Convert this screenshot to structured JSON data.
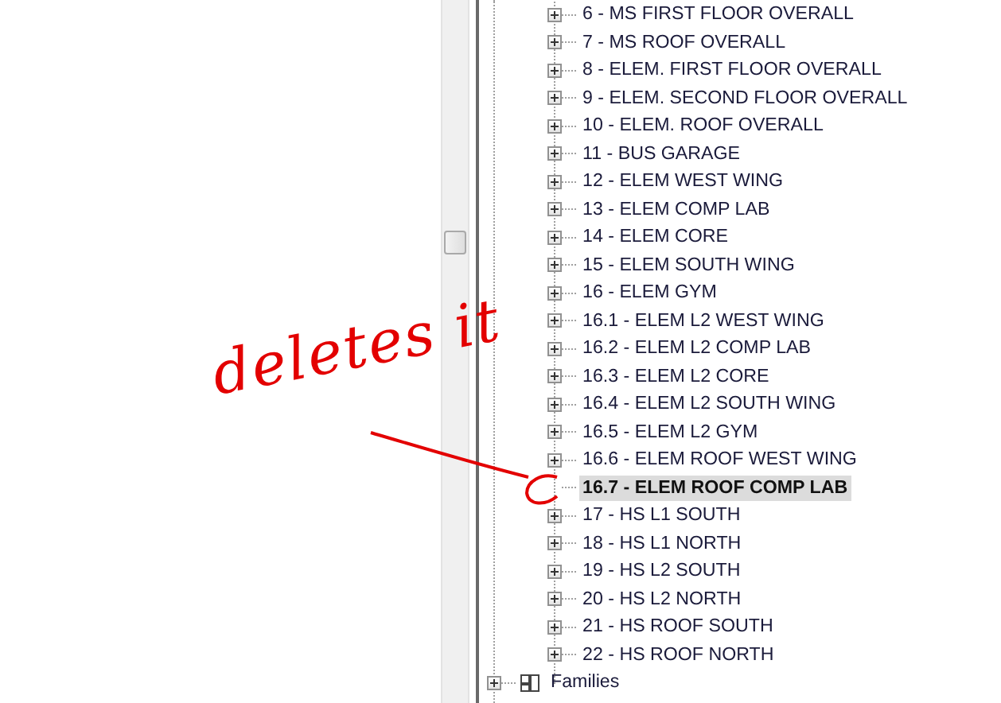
{
  "tree": {
    "items": [
      {
        "label": "6 - MS FIRST FLOOR OVERALL",
        "expandable": true,
        "selected": false
      },
      {
        "label": "7 - MS ROOF OVERALL",
        "expandable": true,
        "selected": false
      },
      {
        "label": "8 - ELEM. FIRST FLOOR OVERALL",
        "expandable": true,
        "selected": false
      },
      {
        "label": "9 - ELEM. SECOND FLOOR OVERALL",
        "expandable": true,
        "selected": false
      },
      {
        "label": "10 - ELEM. ROOF OVERALL",
        "expandable": true,
        "selected": false
      },
      {
        "label": "11 - BUS GARAGE",
        "expandable": true,
        "selected": false
      },
      {
        "label": "12 - ELEM WEST WING",
        "expandable": true,
        "selected": false
      },
      {
        "label": "13 - ELEM COMP LAB",
        "expandable": true,
        "selected": false
      },
      {
        "label": "14 - ELEM CORE",
        "expandable": true,
        "selected": false
      },
      {
        "label": "15 - ELEM SOUTH WING",
        "expandable": true,
        "selected": false
      },
      {
        "label": "16 - ELEM GYM",
        "expandable": true,
        "selected": false
      },
      {
        "label": "16.1 - ELEM L2 WEST WING",
        "expandable": true,
        "selected": false
      },
      {
        "label": "16.2 - ELEM L2 COMP LAB",
        "expandable": true,
        "selected": false
      },
      {
        "label": "16.3 - ELEM L2 CORE",
        "expandable": true,
        "selected": false
      },
      {
        "label": "16.4 - ELEM L2 SOUTH WING",
        "expandable": true,
        "selected": false
      },
      {
        "label": "16.5 - ELEM L2 GYM",
        "expandable": true,
        "selected": false
      },
      {
        "label": "16.6 - ELEM ROOF WEST WING",
        "expandable": true,
        "selected": false
      },
      {
        "label": "16.7 - ELEM ROOF COMP LAB",
        "expandable": false,
        "selected": true
      },
      {
        "label": "17 - HS L1 SOUTH",
        "expandable": true,
        "selected": false
      },
      {
        "label": "18 - HS L1 NORTH",
        "expandable": true,
        "selected": false
      },
      {
        "label": "19 - HS L2 SOUTH",
        "expandable": true,
        "selected": false
      },
      {
        "label": "20 - HS L2 NORTH",
        "expandable": true,
        "selected": false
      },
      {
        "label": "21 - HS ROOF SOUTH",
        "expandable": true,
        "selected": false
      },
      {
        "label": "22 - HS ROOF NORTH",
        "expandable": true,
        "selected": false
      }
    ],
    "families": {
      "label": "Families",
      "expandable": true,
      "selected": false
    }
  },
  "annotation": {
    "text": "deletes it"
  }
}
